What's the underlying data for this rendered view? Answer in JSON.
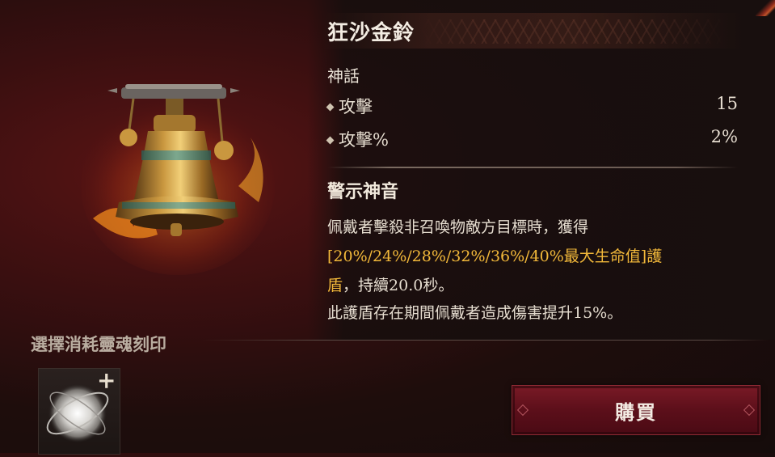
{
  "item": {
    "title": "狂沙金鈴",
    "rarity": "神話",
    "stats": [
      {
        "label": "攻擊",
        "value": "15"
      },
      {
        "label": "攻擊%",
        "value": "2%"
      }
    ]
  },
  "skill": {
    "name": "警示神音",
    "line1": "佩戴者擊殺非召喚物敵方目標時，獲得",
    "line2_gold": "[20%/24%/28%/32%/36%/40%最大生命值]護",
    "line3_gold": "盾",
    "line3_rest": "，持續20.0秒。",
    "line4": "此護盾存在期間佩戴者造成傷害提升15%。"
  },
  "consume": {
    "label": "選擇消耗靈魂刻印",
    "slot_icon": "soul-orb-icon",
    "add_symbol": "+"
  },
  "buy_button": {
    "label": "購買"
  },
  "colors": {
    "gold": "#f2b83a",
    "button": "#6a1420",
    "background": "#1e0d0c"
  }
}
